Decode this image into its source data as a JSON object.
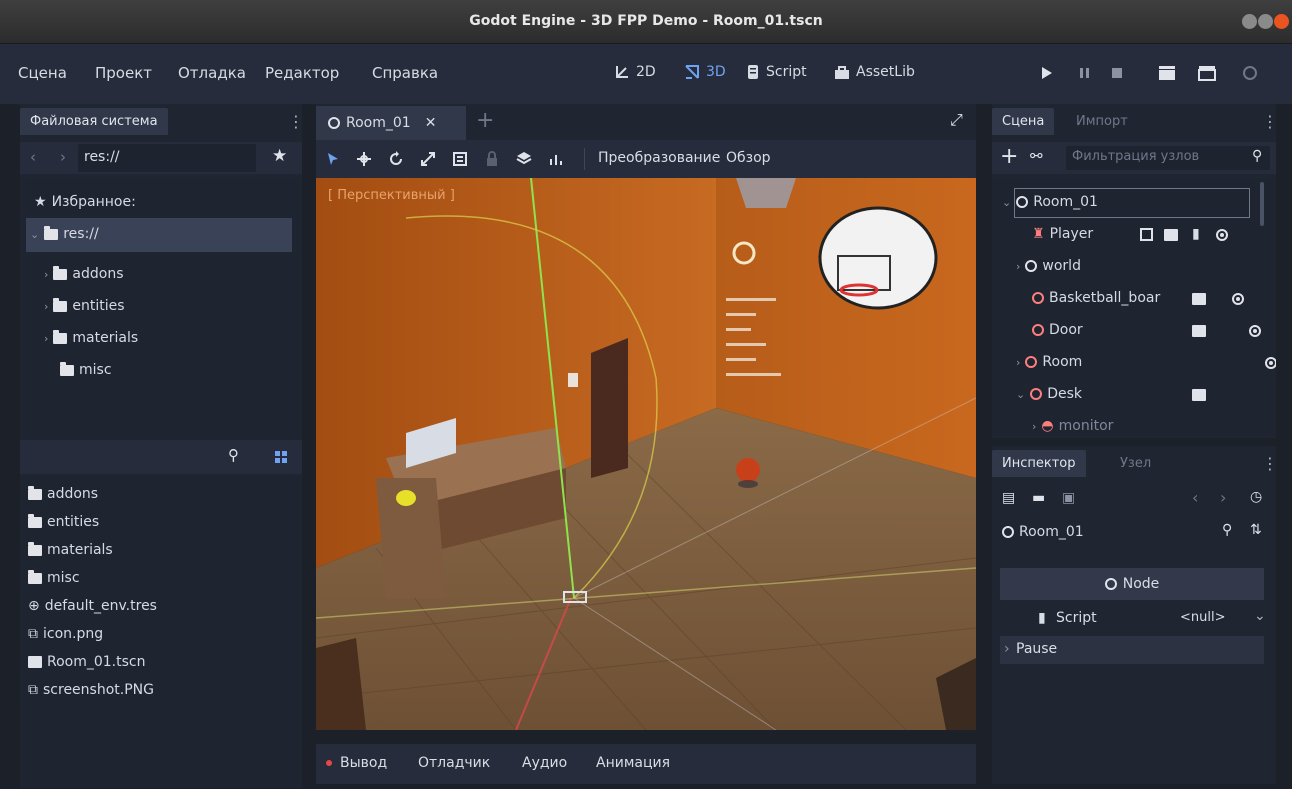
{
  "window": {
    "title": "Godot Engine - 3D FPP Demo - Room_01.tscn"
  },
  "menu": {
    "scene": "Сцена",
    "project": "Проект",
    "debug": "Отладка",
    "editor": "Редактор",
    "help": "Справка"
  },
  "modes": {
    "2d": "2D",
    "3d": "3D",
    "script": "Script",
    "assetlib": "AssetLib"
  },
  "filesystem": {
    "tab": "Файловая система",
    "path": "res://",
    "favorites": "Избранное:",
    "root": "res://",
    "tree": [
      "addons",
      "entities",
      "materials",
      "misc"
    ],
    "files": [
      "addons",
      "entities",
      "materials",
      "misc",
      "default_env.tres",
      "icon.png",
      "Room_01.tscn",
      "screenshot.PNG"
    ]
  },
  "editor_tab": {
    "name": "Room_01"
  },
  "toolbar": {
    "transform": "Преобразование",
    "view": "Обзор"
  },
  "viewport": {
    "label": "[ Перспективный ]"
  },
  "bottom": {
    "output": "Вывод",
    "debugger": "Отладчик",
    "audio": "Аудио",
    "animation": "Анимация"
  },
  "scene_dock": {
    "tab_scene": "Сцена",
    "tab_import": "Импорт",
    "filter_placeholder": "Фильтрация узлов",
    "nodes": [
      "Room_01",
      "Player",
      "world",
      "Basketball_boar",
      "Door",
      "Room",
      "Desk",
      "monitor"
    ]
  },
  "inspector": {
    "tab_inspector": "Инспектор",
    "tab_node": "Узел",
    "object": "Room_01",
    "category": "Node",
    "script_label": "Script",
    "script_value": "<null>",
    "pause": "Pause"
  },
  "colors": {
    "accent": "#6ea3f2",
    "bg": "#202532",
    "node_red": "#fc7f7f",
    "wall": "#c8691e"
  }
}
